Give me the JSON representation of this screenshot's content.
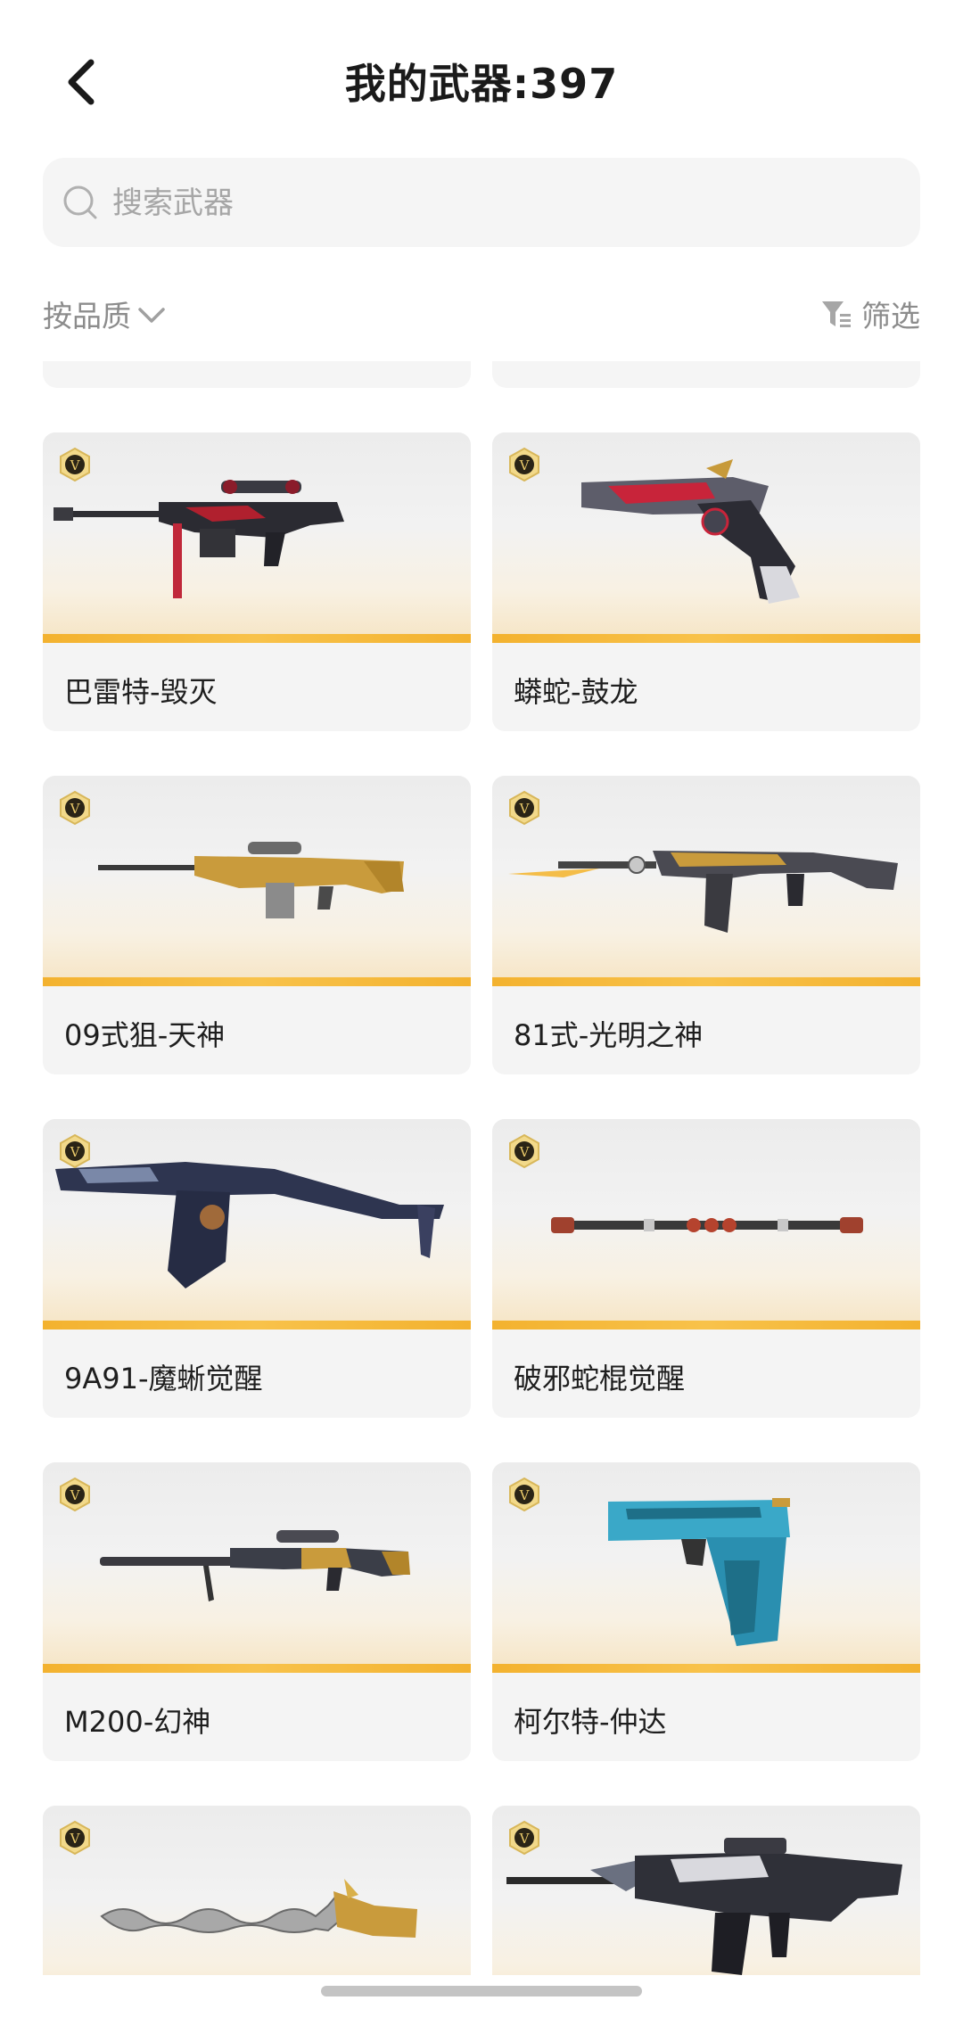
{
  "header": {
    "title": "我的武器:397"
  },
  "search": {
    "placeholder": "搜索武器",
    "value": ""
  },
  "toolbar": {
    "sort_label": "按品质",
    "filter_label": "筛选"
  },
  "badge_letter": "V",
  "colors": {
    "accent": "#F3B22F",
    "card_bg": "#F4F4F4",
    "muted_text": "#8C8C8C"
  },
  "weapons": [
    {
      "name": "巴雷特-毁灭",
      "icon": "sniper-rifle-red-black"
    },
    {
      "name": "蟒蛇-鼓龙",
      "icon": "revolver-red-silver"
    },
    {
      "name": "09式狙-天神",
      "icon": "sniper-rifle-gold"
    },
    {
      "name": "81式-光明之神",
      "icon": "assault-rifle-gold"
    },
    {
      "name": "9A91-魔蜥觉醒",
      "icon": "rifle-dark-blue"
    },
    {
      "name": "破邪蛇棍觉醒",
      "icon": "staff-melee"
    },
    {
      "name": "M200-幻神",
      "icon": "sniper-rifle-dark-gold"
    },
    {
      "name": "柯尔特-仲达",
      "icon": "pistol-blue"
    },
    {
      "name": "",
      "icon": "wavy-blade-gold"
    },
    {
      "name": "",
      "icon": "assault-rifle-silver-black"
    }
  ]
}
